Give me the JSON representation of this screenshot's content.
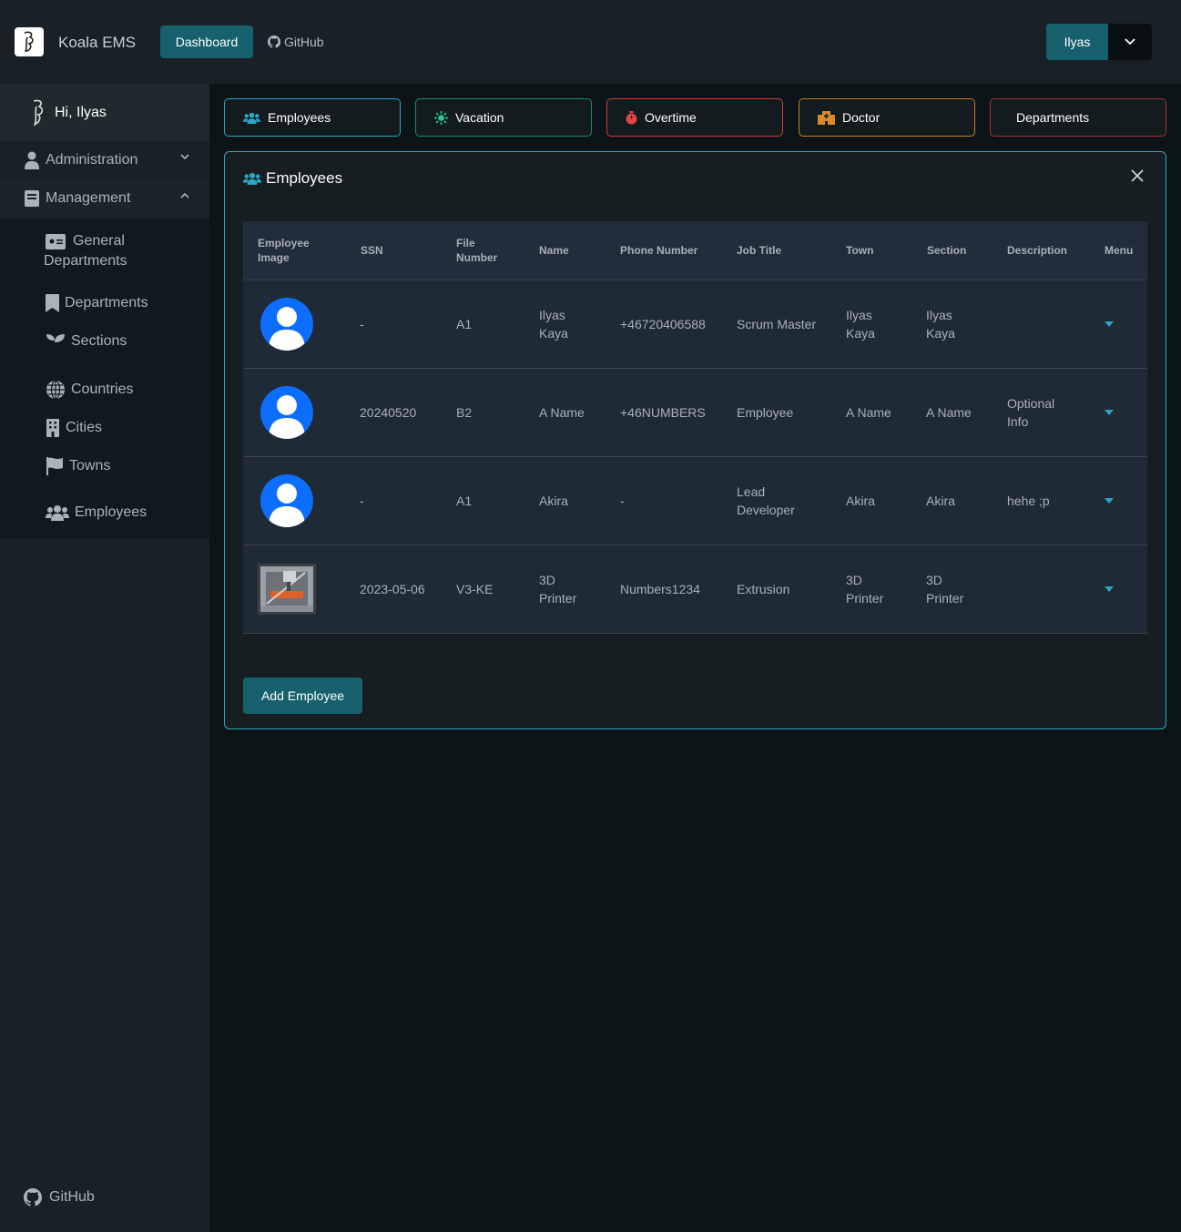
{
  "app": {
    "brand": "Koala EMS"
  },
  "header": {
    "dashboard_label": "Dashboard",
    "github_label": "GitHub",
    "user_label": "Ilyas"
  },
  "sidebar": {
    "greeting": "Hi, Ilyas",
    "administration": "Administration",
    "management": "Management",
    "items": {
      "general_departments_1": "General",
      "general_departments_2": "Departments",
      "departments": "Departments",
      "sections": "Sections",
      "countries": "Countries",
      "cities": "Cities",
      "towns": "Towns",
      "employees": "Employees"
    },
    "footer_github": "GitHub"
  },
  "tabs": {
    "employees": "Employees",
    "vacation": "Vacation",
    "overtime": "Overtime",
    "doctor": "Doctor",
    "departments": "Departments"
  },
  "panel": {
    "title": "Employees",
    "add_label": "Add Employee"
  },
  "table": {
    "headers": {
      "image_1": "Employee",
      "image_2": "Image",
      "ssn": "SSN",
      "file_1": "File",
      "file_2": "Number",
      "name": "Name",
      "phone": "Phone Number",
      "job": "Job Title",
      "town": "Town",
      "section": "Section",
      "description": "Description",
      "menu": "Menu"
    },
    "rows": [
      {
        "ssn": "-",
        "file": "A1",
        "name_1": "Ilyas",
        "name_2": "Kaya",
        "phone": "+46720406588",
        "job_1": "Scrum Master",
        "job_2": "",
        "town_1": "Ilyas",
        "town_2": "Kaya",
        "section_1": "Ilyas",
        "section_2": "Kaya",
        "desc_1": "",
        "desc_2": ""
      },
      {
        "ssn": "20240520",
        "file": "B2",
        "name_1": "A Name",
        "name_2": "",
        "phone": "+46NUMBERS",
        "job_1": "Employee",
        "job_2": "",
        "town_1": "A Name",
        "town_2": "",
        "section_1": "A Name",
        "section_2": "",
        "desc_1": "Optional",
        "desc_2": "Info"
      },
      {
        "ssn": "-",
        "file": "A1",
        "name_1": "Akira",
        "name_2": "",
        "phone": "-",
        "job_1": "Lead",
        "job_2": "Developer",
        "town_1": "Akira",
        "town_2": "",
        "section_1": "Akira",
        "section_2": "",
        "desc_1": "hehe ;p",
        "desc_2": ""
      },
      {
        "ssn": "2023-05-06",
        "file": "V3-KE",
        "name_1": "3D",
        "name_2": "Printer",
        "phone": "Numbers1234",
        "job_1": "Extrusion",
        "job_2": "",
        "town_1": "3D",
        "town_2": "Printer",
        "section_1": "3D",
        "section_2": "Printer",
        "desc_1": "",
        "desc_2": ""
      }
    ]
  },
  "colors": {
    "accent": "#17606e",
    "cyan": "#2aa6c4",
    "green": "#1f8a6c",
    "red": "#d63a3a",
    "orange": "#c97d1e",
    "avatar": "#0d6efd"
  }
}
